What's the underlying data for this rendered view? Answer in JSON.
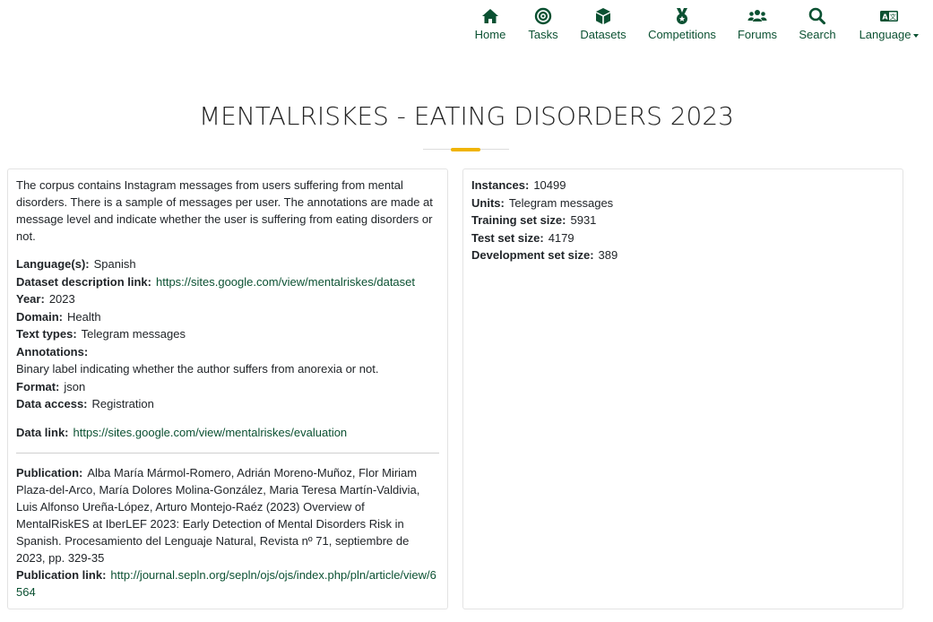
{
  "nav": {
    "items": [
      {
        "label": "Home",
        "icon": "home-icon"
      },
      {
        "label": "Tasks",
        "icon": "target-icon"
      },
      {
        "label": "Datasets",
        "icon": "cube-icon"
      },
      {
        "label": "Competitions",
        "icon": "medal-icon"
      },
      {
        "label": "Forums",
        "icon": "users-icon"
      },
      {
        "label": "Search",
        "icon": "search-icon"
      },
      {
        "label": "Language",
        "icon": "language-icon"
      }
    ],
    "accent_color": "#0b5132"
  },
  "page": {
    "title": "MENTALRISKES - EATING DISORDERS 2023",
    "title_accent_color": "#f0b400"
  },
  "dataset": {
    "description": "The corpus contains Instagram messages from users suffering from mental disorders. There is a sample of messages per user.  The annotations are made at message level and indicate whether the user is suffering from eating disorders or not.",
    "language_label": "Language(s):",
    "language": "Spanish",
    "desc_link_label": "Dataset description link:",
    "desc_link": "https://sites.google.com/view/mentalriskes/dataset",
    "year_label": "Year:",
    "year": "2023",
    "domain_label": "Domain:",
    "domain": "Health",
    "text_types_label": "Text types:",
    "text_types": "Telegram messages",
    "annotations_label": "Annotations:",
    "annotations": "Binary label indicating whether the author suffers from anorexia or not.",
    "format_label": "Format:",
    "format": "json",
    "access_label": "Data access:",
    "access": "Registration",
    "data_link_label": "Data link:",
    "data_link": "https://sites.google.com/view/mentalriskes/evaluation",
    "publication_label": "Publication:",
    "publication": "Alba María Mármol-Romero, Adrián Moreno-Muñoz, Flor Miriam Plaza-del-Arco, María Dolores Molina-González, Maria Teresa Martín-Valdivia, Luis Alfonso Ureña-López, Arturo Montejo-Raéz (2023) Overview of MentalRiskES at IberLEF 2023: Early Detection of Mental Disorders Risk in Spanish. Procesamiento del Lenguaje Natural, Revista nº 71, septiembre de 2023, pp. 329-35",
    "publication_link_label": "Publication link:",
    "publication_link": "http://journal.sepln.org/sepln/ojs/ojs/index.php/pln/article/view/6564"
  },
  "stats": {
    "instances_label": "Instances:",
    "instances": "10499",
    "units_label": "Units:",
    "units": "Telegram messages",
    "train_label": "Training set size:",
    "train": "5931",
    "test_label": "Test set size:",
    "test": "4179",
    "dev_label": "Development set size:",
    "dev": "389"
  }
}
